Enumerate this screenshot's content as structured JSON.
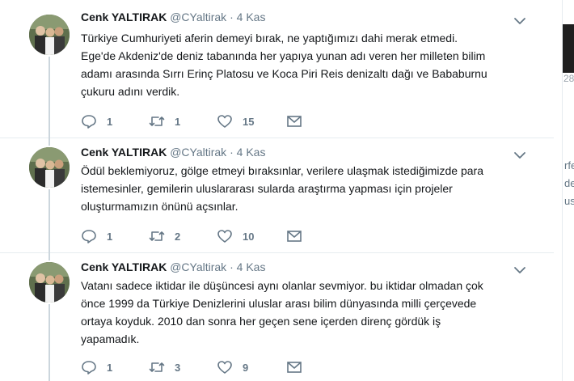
{
  "tweets": [
    {
      "fullname": "Cenk YALTIRAK",
      "username": "@CYaltirak",
      "separator": "·",
      "time": "4 Kas",
      "text": "Türkiye Cumhuriyeti aferin demeyi bırak,  ne yaptığımızı dahi merak etmedi.\nEge'de Akdeniz'de deniz tabanında her yapıya yunan adı veren her milleten bilim\nadamı arasında Sırrı Erinç Platosu ve Koca Piri Reis denizaltı dağı ve Bababurnu\nçukuru  adını verdik.",
      "replies": "1",
      "retweets": "1",
      "likes": "15"
    },
    {
      "fullname": "Cenk YALTIRAK",
      "username": "@CYaltirak",
      "separator": "·",
      "time": "4 Kas",
      "text": "Ödül beklemiyoruz, gölge etmeyi bıraksınlar, verilere ulaşmak istediğimizde para\nistemesinler,  gemilerin uluslararası sularda araştırma yapması için projeler\noluşturmamızın önünü açsınlar.",
      "replies": "1",
      "retweets": "2",
      "likes": "10"
    },
    {
      "fullname": "Cenk YALTIRAK",
      "username": "@CYaltirak",
      "separator": "·",
      "time": "4 Kas",
      "text": "Vatanı sadece iktidar ile düşüncesi aynı olanlar sevmiyor.  bu iktidar olmadan çok\nönce 1999 da Türkiye Denizlerini uluslar arası bilim dünyasında milli çerçevede\nortaya koyduk.  2010 dan sonra her geçen sene içerden direnç gördük iş\nyapamadık.",
      "replies": "1",
      "retweets": "3",
      "likes": "9"
    }
  ],
  "right_strip": {
    "number_fragment": "28",
    "lines": [
      "rfe",
      "de",
      "usla"
    ]
  },
  "colors": {
    "text": "#14171a",
    "secondary": "#657786",
    "divider": "#e6ecf0",
    "thread_line": "#ccd6dd"
  },
  "icons": {
    "reply": "reply-icon",
    "retweet": "retweet-icon",
    "like": "heart-icon",
    "message": "envelope-icon",
    "menu": "chevron-down-icon"
  }
}
